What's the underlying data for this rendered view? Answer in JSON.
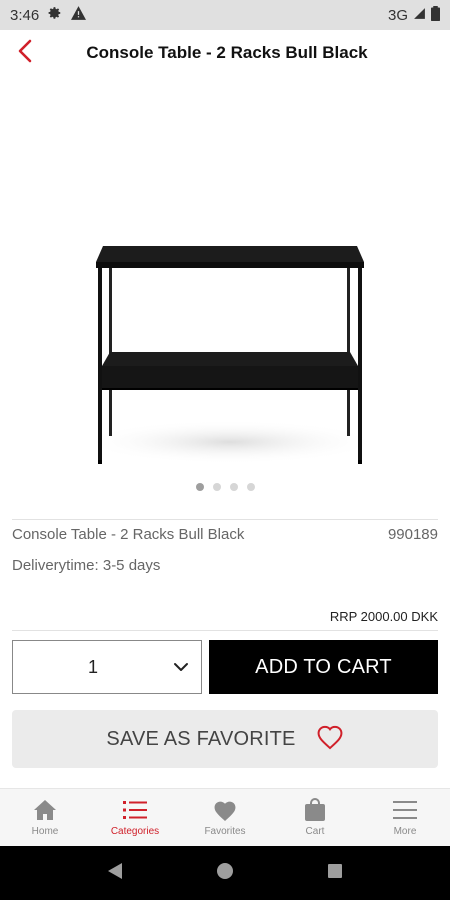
{
  "status_bar": {
    "time": "3:46",
    "network": "3G",
    "icons": [
      "gear-icon",
      "warning-icon",
      "signal-icon",
      "battery-icon"
    ]
  },
  "header": {
    "title": "Console Table - 2 Racks Bull Black",
    "back_icon": "chevron-left-icon"
  },
  "gallery": {
    "image": "console-table-image",
    "page_count": 4,
    "active_index": 0
  },
  "product": {
    "name": "Console Table - 2 Racks Bull Black",
    "sku": "990189",
    "delivery": "Deliverytime: 3-5 days",
    "price": "RRP 2000.00 DKK"
  },
  "actions": {
    "quantity": "1",
    "add_to_cart": "ADD TO CART",
    "save_favorite": "SAVE AS FAVORITE"
  },
  "bottom_nav": {
    "items": [
      {
        "label": "Home",
        "icon": "home-icon",
        "active": false
      },
      {
        "label": "Categories",
        "icon": "list-icon",
        "active": true
      },
      {
        "label": "Favorites",
        "icon": "heart-icon",
        "active": false
      },
      {
        "label": "Cart",
        "icon": "bag-icon",
        "active": false
      },
      {
        "label": "More",
        "icon": "menu-icon",
        "active": false
      }
    ]
  },
  "colors": {
    "accent": "#d0202a",
    "button_dark": "#000000",
    "favorite_bg": "#ebebeb",
    "inactive_icon": "#8a8a8a"
  }
}
